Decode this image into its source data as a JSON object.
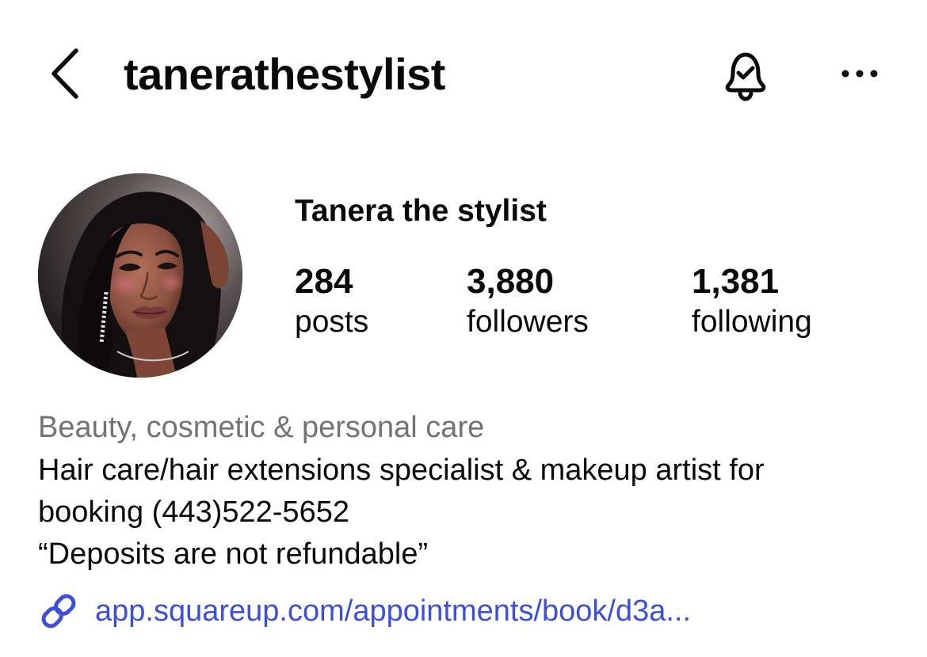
{
  "header": {
    "username": "tanerathestylist",
    "icons": {
      "back": "chevron-left-icon",
      "notifications": "bell-check-icon",
      "more": "more-horizontal-icon"
    }
  },
  "profile": {
    "display_name": "Tanera the stylist",
    "avatar": "profile-photo",
    "stats": {
      "posts": {
        "count": "284",
        "label": "posts"
      },
      "followers": {
        "count": "3,880",
        "label": "followers"
      },
      "following": {
        "count": "1,381",
        "label": "following"
      }
    },
    "category": "Beauty, cosmetic & personal care",
    "bio": {
      "line1": "Hair care/hair extensions specialist & makeup artist for",
      "line2": "booking (443)522-5652",
      "line3": "“Deposits are not refundable”"
    },
    "link": {
      "icon": "link-icon",
      "text": "app.squareup.com/appointments/book/d3a..."
    }
  },
  "colors": {
    "text_primary": "#0a0a0a",
    "text_secondary": "#737373",
    "link": "#3d4fd6",
    "background": "#ffffff"
  }
}
